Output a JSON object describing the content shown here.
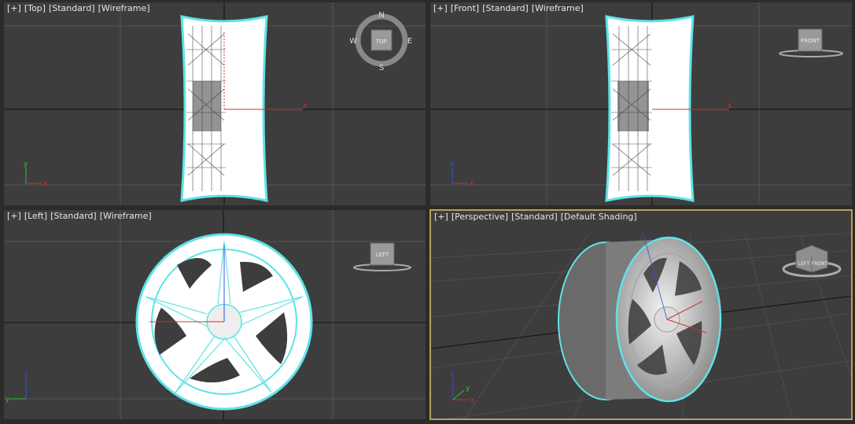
{
  "viewports": {
    "top": {
      "plus": "[+]",
      "view": "[Top]",
      "mode": "[Standard]",
      "shading": "[Wireframe]",
      "viewcube": "TOP",
      "compass": {
        "n": "N",
        "s": "S",
        "e": "E",
        "w": "W"
      },
      "axis": {
        "x": "x",
        "y": "y",
        "z": "z"
      }
    },
    "front": {
      "plus": "[+]",
      "view": "[Front]",
      "mode": "[Standard]",
      "shading": "[Wireframe]",
      "viewcube": "FRONT",
      "axis": {
        "x": "x",
        "z": "z"
      }
    },
    "left": {
      "plus": "[+]",
      "view": "[Left]",
      "mode": "[Standard]",
      "shading": "[Wireframe]",
      "viewcube": "LEFT",
      "axis": {
        "y": "y",
        "z": "z"
      }
    },
    "perspective": {
      "plus": "[+]",
      "view": "[Perspective]",
      "mode": "[Standard]",
      "shading": "[Default Shading]",
      "viewcube_a": "LEFT",
      "viewcube_b": "FRONT",
      "axis": {
        "x": "x",
        "y": "y",
        "z": "z"
      }
    }
  },
  "colors": {
    "viewport_bg": "#3d3d3d",
    "grid": "#555555",
    "selection": "#5fe3e6",
    "active_border": "#b7a25a",
    "axis_x": "#d03030",
    "axis_y": "#30c030",
    "axis_z": "#3050e0"
  }
}
